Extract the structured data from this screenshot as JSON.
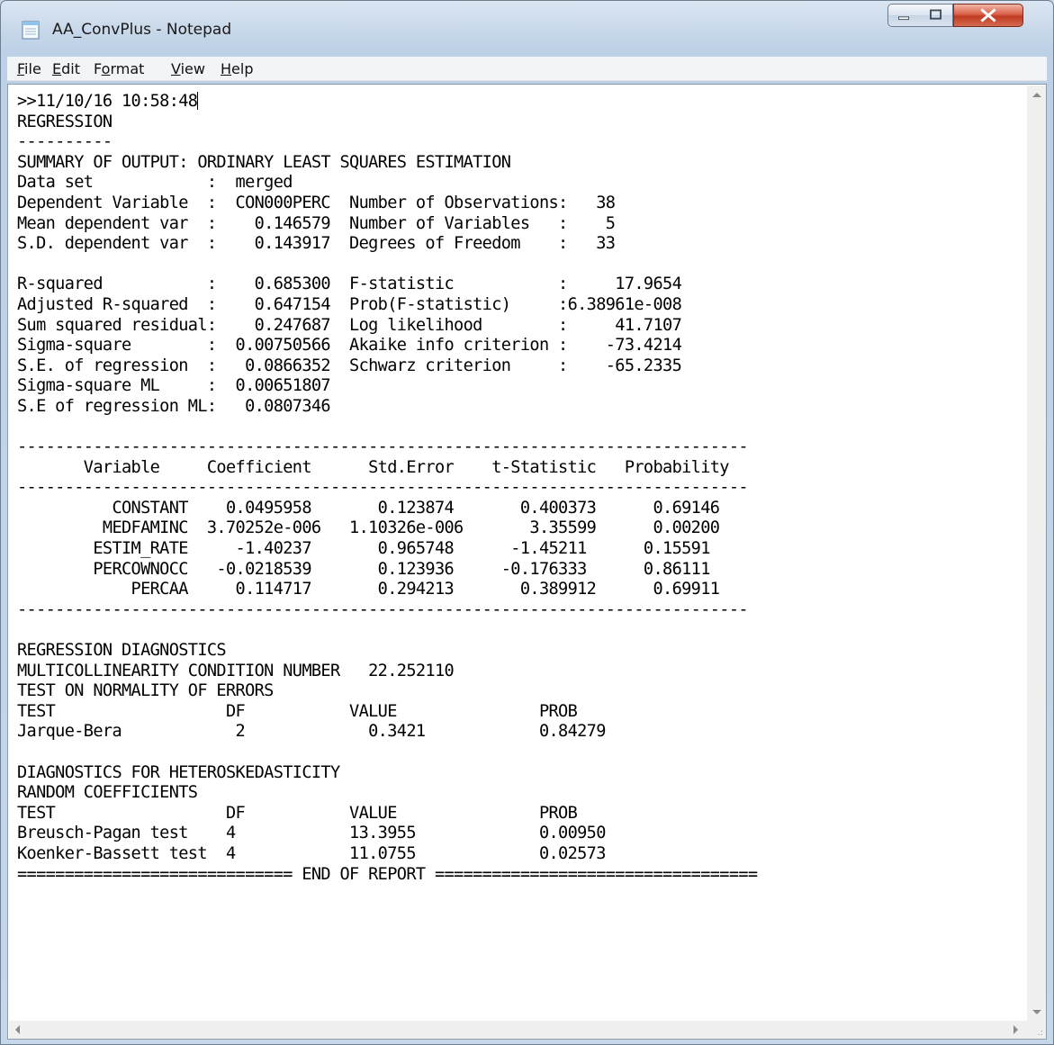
{
  "window": {
    "title": "AA_ConvPlus - Notepad",
    "icon": "notepad-icon"
  },
  "menu": [
    {
      "accel": "F",
      "rest": "ile"
    },
    {
      "accel": "E",
      "rest": "dit"
    },
    {
      "pre": "F",
      "accel": "o",
      "rest": "rmat"
    },
    {
      "accel": "V",
      "rest": "iew"
    },
    {
      "accel": "H",
      "rest": "elp"
    }
  ],
  "document": {
    "first_line": ">>11/10/16 10:58:48",
    "lines": [
      "REGRESSION",
      "----------",
      "SUMMARY OF OUTPUT: ORDINARY LEAST SQUARES ESTIMATION",
      "Data set            :  merged",
      "Dependent Variable  :  CON000PERC  Number of Observations:   38",
      "Mean dependent var  :    0.146579  Number of Variables   :    5",
      "S.D. dependent var  :    0.143917  Degrees of Freedom    :   33",
      "",
      "R-squared           :    0.685300  F-statistic           :     17.9654",
      "Adjusted R-squared  :    0.647154  Prob(F-statistic)     :6.38961e-008",
      "Sum squared residual:    0.247687  Log likelihood        :     41.7107",
      "Sigma-square        :  0.00750566  Akaike info criterion :    -73.4214",
      "S.E. of regression  :   0.0866352  Schwarz criterion     :    -65.2335",
      "Sigma-square ML     :  0.00651807",
      "S.E of regression ML:   0.0807346",
      "",
      "-----------------------------------------------------------------------------",
      "       Variable     Coefficient      Std.Error    t-Statistic   Probability",
      "-----------------------------------------------------------------------------",
      "          CONSTANT    0.0495958       0.123874       0.400373      0.69146",
      "         MEDFAMINC  3.70252e-006   1.10326e-006       3.35599      0.00200",
      "        ESTIM_RATE     -1.40237       0.965748      -1.45211      0.15591",
      "        PERCOWNOCC   -0.0218539       0.123936     -0.176333      0.86111",
      "            PERCAA     0.114717       0.294213       0.389912      0.69911",
      "-----------------------------------------------------------------------------",
      "",
      "REGRESSION DIAGNOSTICS",
      "MULTICOLLINEARITY CONDITION NUMBER   22.252110",
      "TEST ON NORMALITY OF ERRORS",
      "TEST                  DF           VALUE               PROB",
      "Jarque-Bera            2             0.3421            0.84279",
      "",
      "DIAGNOSTICS FOR HETEROSKEDASTICITY",
      "RANDOM COEFFICIENTS",
      "TEST                  DF           VALUE               PROB",
      "Breusch-Pagan test    4            13.3955             0.00950",
      "Koenker-Bassett test  4            11.0755             0.02573",
      "============================= END OF REPORT =================================="
    ]
  }
}
